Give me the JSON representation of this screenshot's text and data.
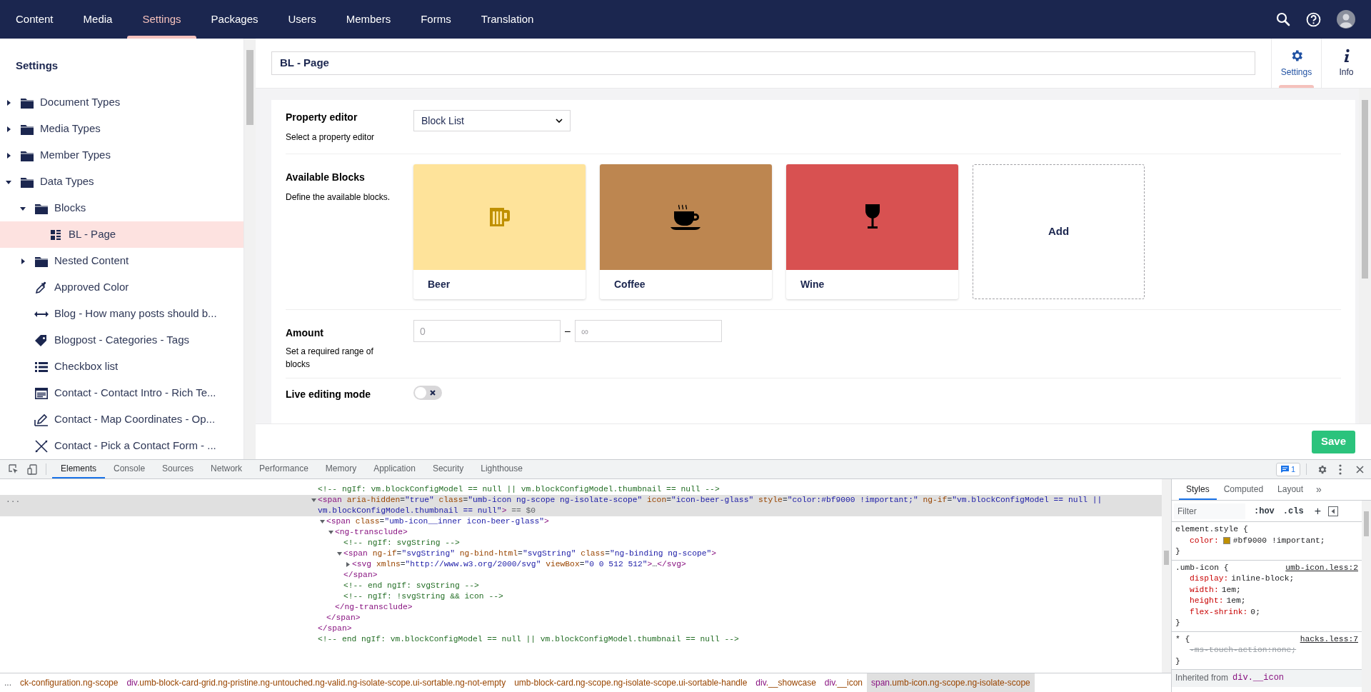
{
  "nav": {
    "sections": [
      {
        "label": "Content",
        "selected": false
      },
      {
        "label": "Media",
        "selected": false
      },
      {
        "label": "Settings",
        "selected": true
      },
      {
        "label": "Packages",
        "selected": false
      },
      {
        "label": "Users",
        "selected": false
      },
      {
        "label": "Members",
        "selected": false
      },
      {
        "label": "Forms",
        "selected": false
      },
      {
        "label": "Translation",
        "selected": false
      }
    ]
  },
  "sidebar": {
    "title": "Settings",
    "tree": [
      {
        "label": "Document Types",
        "kind": "folder",
        "expanded": false,
        "selected": false
      },
      {
        "label": "Media Types",
        "kind": "folder",
        "expanded": false,
        "selected": false
      },
      {
        "label": "Member Types",
        "kind": "folder",
        "expanded": false,
        "selected": false
      },
      {
        "label": "Data Types",
        "kind": "folder",
        "expanded": true,
        "selected": false,
        "children": [
          {
            "label": "Blocks",
            "kind": "folder",
            "expanded": true,
            "selected": false,
            "children": [
              {
                "label": "BL - Page",
                "kind": "block-list",
                "selected": true
              }
            ]
          },
          {
            "label": "Nested Content",
            "kind": "folder",
            "expanded": false,
            "selected": false
          },
          {
            "label": "Approved Color",
            "kind": "color-picker",
            "selected": false
          },
          {
            "label": "Blog - How many posts should b...",
            "kind": "slider",
            "selected": false
          },
          {
            "label": "Blogpost - Categories - Tags",
            "kind": "tags",
            "selected": false
          },
          {
            "label": "Checkbox list",
            "kind": "checkbox-list",
            "selected": false
          },
          {
            "label": "Contact - Contact Intro - Rich Te...",
            "kind": "rich-text",
            "selected": false
          },
          {
            "label": "Contact - Map Coordinates - Op...",
            "kind": "map",
            "selected": false
          },
          {
            "label": "Contact - Pick a Contact Form - ...",
            "kind": "form-picker",
            "selected": false
          }
        ]
      }
    ]
  },
  "editor": {
    "name": "BL - Page",
    "apps": [
      {
        "label": "Settings",
        "kind": "settings",
        "selected": true
      },
      {
        "label": "Info",
        "kind": "info",
        "selected": false
      }
    ],
    "property_editor": {
      "label": "Property editor",
      "description": "Select a property editor",
      "value": "Block List"
    },
    "available_blocks": {
      "label": "Available Blocks",
      "description": "Define the available blocks.",
      "blocks": [
        {
          "name": "Beer",
          "kind": "beer",
          "color": "#fee39a"
        },
        {
          "name": "Coffee",
          "kind": "coffee",
          "color": "#bd8650"
        },
        {
          "name": "Wine",
          "kind": "wine",
          "color": "#d85151"
        }
      ],
      "add_label": "Add"
    },
    "amount": {
      "label": "Amount",
      "description": "Set a required range of blocks",
      "min_placeholder": "0",
      "separator": "–",
      "max_placeholder": "∞"
    },
    "live_editing": {
      "label": "Live editing mode",
      "on": false
    },
    "save_button": "Save"
  },
  "devtools": {
    "tabs": [
      {
        "label": "Elements",
        "selected": true
      },
      {
        "label": "Console",
        "selected": false
      },
      {
        "label": "Sources",
        "selected": false
      },
      {
        "label": "Network",
        "selected": false
      },
      {
        "label": "Performance",
        "selected": false
      },
      {
        "label": "Memory",
        "selected": false
      },
      {
        "label": "Application",
        "selected": false
      },
      {
        "label": "Security",
        "selected": false
      },
      {
        "label": "Lighthouse",
        "selected": false
      }
    ],
    "issues_count": "1",
    "dom": [
      {
        "text": "<!-- ngIf: vm.blockConfigModel == null || vm.blockConfigModel.thumbnail == null -->",
        "selected": false
      },
      {
        "text": "<span aria-hidden=\"true\" class=\"umb-icon ng-scope ng-isolate-scope\" icon=\"icon-beer-glass\" style=\"color:#bf9000 !important;\" ng-if=\"vm.blockConfigModel == null || vm.blockConfigModel.thumbnail == null\">",
        "selected": true,
        "marker": "...",
        "suffix": "== $0",
        "expanded": true,
        "closing": "</span>",
        "children": [
          {
            "text": "<span class=\"umb-icon__inner icon-beer-glass\">",
            "selected": false,
            "expanded": true,
            "closing": "</span>",
            "children": [
              {
                "text": "<ng-transclude>",
                "selected": false,
                "expanded": true,
                "closing": "</ng-transclude>",
                "children": [
                  {
                    "text": "<!-- ngIf: svgString -->",
                    "selected": false
                  },
                  {
                    "text": "<span ng-if=\"svgString\" ng-bind-html=\"svgString\" class=\"ng-binding ng-scope\">",
                    "selected": false,
                    "expanded": true,
                    "closing": "</span>",
                    "children": [
                      {
                        "text": "<svg xmlns=\"http://www.w3.org/2000/svg\" viewBox=\"0 0 512 512\">…</svg>",
                        "selected": false,
                        "expanded": false
                      }
                    ]
                  },
                  {
                    "text": "<!-- end ngIf: svgString -->",
                    "selected": false
                  },
                  {
                    "text": "<!-- ngIf: !svgString && icon -->",
                    "selected": false
                  }
                ]
              }
            ]
          }
        ]
      },
      {
        "text": "<!-- end ngIf: vm.blockConfigModel == null || vm.blockConfigModel.thumbnail == null -->",
        "selected": false
      }
    ],
    "styles_tabs": [
      {
        "label": "Styles",
        "selected": true
      },
      {
        "label": "Computed",
        "selected": false
      },
      {
        "label": "Layout",
        "selected": false
      }
    ],
    "styles_more": "»",
    "filter_placeholder": "Filter",
    "hov": ":hov",
    "cls": ".cls",
    "add": "+",
    "rules": [
      {
        "selector": "element.style {",
        "declarations": [
          {
            "property": "color:",
            "value": "#bf9000 !important;",
            "color": "#bf9000",
            "overridden": false
          }
        ],
        "close": "}"
      },
      {
        "selector": ".umb-icon {",
        "source": "umb-icon.less:2",
        "declarations": [
          {
            "property": "display:",
            "value": "inline-block;",
            "overridden": false
          },
          {
            "property": "width:",
            "value": "1em;",
            "overridden": false
          },
          {
            "property": "height:",
            "value": "1em;",
            "overridden": false
          },
          {
            "property": "flex-shrink:",
            "value": "0;",
            "overridden": false
          }
        ],
        "close": "}"
      },
      {
        "selector": "* {",
        "source": "hacks.less:7",
        "declarations": [
          {
            "property": "-ms-touch-action:",
            "value": "none;",
            "overridden": true
          }
        ],
        "close": "}"
      }
    ],
    "inherited_label": "Inherited from",
    "inherited_selector": "div.__icon",
    "breadcrumbs": [
      {
        "label": "...",
        "selected": false
      },
      {
        "label": "ck-configuration.ng-scope",
        "selected": false
      },
      {
        "label": "div.umb-block-card-grid.ng-pristine.ng-untouched.ng-valid.ng-isolate-scope.ui-sortable.ng-not-empty",
        "selected": false
      },
      {
        "label": "umb-block-card.ng-scope.ng-isolate-scope.ui-sortable-handle",
        "selected": false
      },
      {
        "label": "div.__showcase",
        "selected": false
      },
      {
        "label": "div.__icon",
        "selected": false
      },
      {
        "label": "span.umb-icon.ng-scope.ng-isolate-scope",
        "selected": true
      }
    ]
  }
}
